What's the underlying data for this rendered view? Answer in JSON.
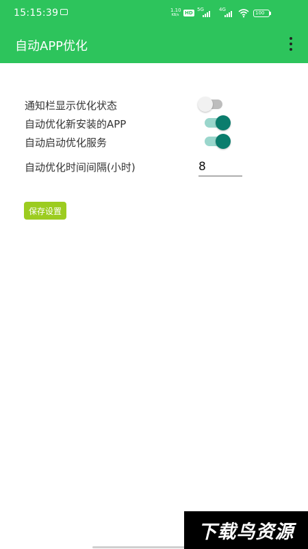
{
  "status_bar": {
    "time": "15:15:39",
    "net_speed_value": "1.10",
    "net_speed_unit": "KB/s",
    "hd_label": "HD",
    "sim1_label": "5G",
    "sim2_label": "4G",
    "battery": "100",
    "icons": [
      "image-icon",
      "hd-icon",
      "signal-icon",
      "wifi-icon",
      "battery-icon"
    ]
  },
  "app_bar": {
    "title": "自动APP优化",
    "menu_icon": "overflow-menu-icon"
  },
  "settings": {
    "notification_label": "通知栏显示优化状态",
    "notification_on": false,
    "auto_new_label": "自动优化新安装的APP",
    "auto_new_on": true,
    "auto_service_label": "自动启动优化服务",
    "auto_service_on": true,
    "interval_label": "自动优化时间间隔(小时)",
    "interval_value": "8"
  },
  "save_button": "保存设置",
  "watermark": "下载鸟资源",
  "colors": {
    "primary": "#2dc45c",
    "switch_on": "#0b7d6d",
    "switch_on_track": "#9ad6cc",
    "switch_off_track": "#bdbdbd",
    "save_button": "#9ccc20"
  }
}
